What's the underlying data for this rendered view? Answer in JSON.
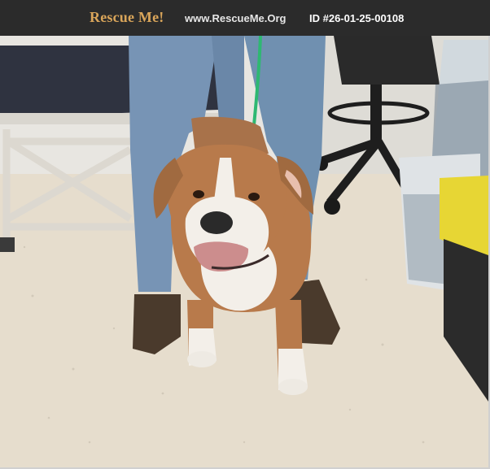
{
  "header": {
    "brand": "Rescue Me!",
    "site_url": "www.RescueMe.Org",
    "pet_id": "ID #26-01-25-00108"
  },
  "photo": {
    "subject": "dog",
    "breed_look": "bulldog",
    "coat_colors": [
      "#b87a4b",
      "#ffffff"
    ],
    "leash_color": "#2eb872"
  },
  "theme": {
    "header_bg": "#2b2b2b",
    "brand_color": "#d9a55a",
    "text_color": "#ffffff"
  }
}
